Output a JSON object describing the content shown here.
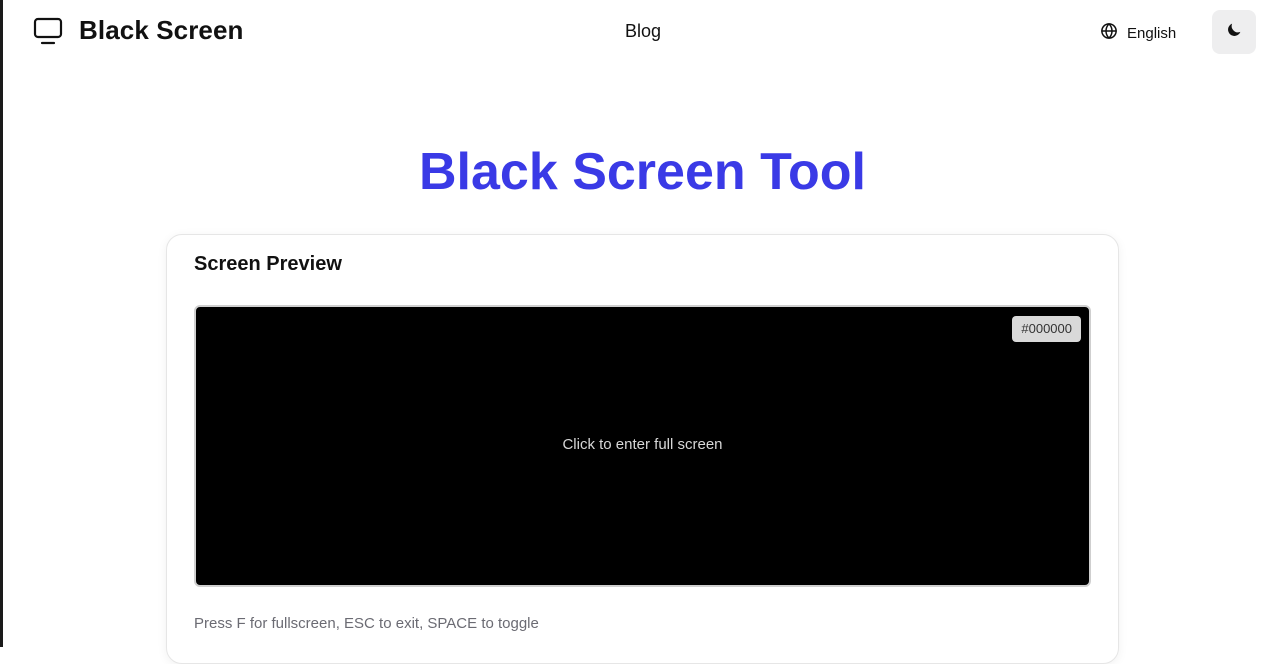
{
  "header": {
    "brand_title": "Black Screen",
    "brand_icon": "monitor-icon",
    "nav_blog": "Blog",
    "language": {
      "icon": "globe-icon",
      "label": "English"
    },
    "theme_toggle_icon": "moon-icon"
  },
  "hero": {
    "title": "Black Screen Tool",
    "title_color": "#3a3ae6"
  },
  "preview_card": {
    "title": "Screen Preview",
    "screen_color": "#000000",
    "color_badge": "#000000",
    "hint": "Click to enter full screen",
    "shortcuts": "Press F for fullscreen, ESC to exit, SPACE to toggle"
  }
}
